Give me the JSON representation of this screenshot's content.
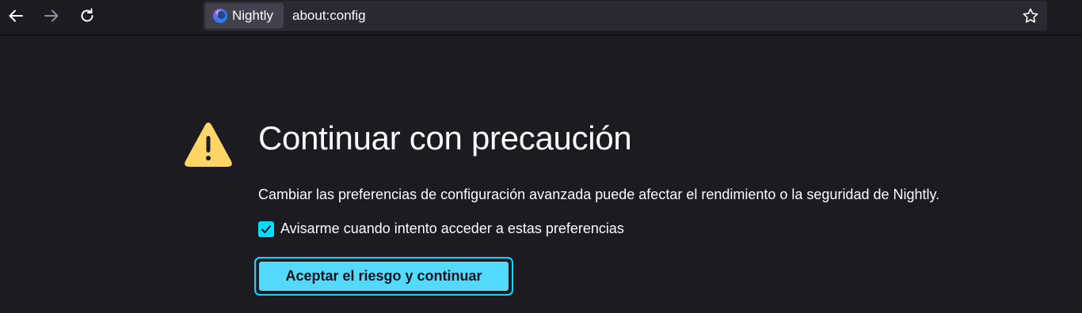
{
  "toolbar": {
    "back_icon": "arrow-left-icon",
    "forward_icon": "arrow-right-icon",
    "reload_icon": "reload-icon",
    "identity_label": "Nightly",
    "identity_icon": "nightly-logo-icon",
    "url": "about:config",
    "bookmark_icon": "star-icon"
  },
  "warning": {
    "icon": "warning-triangle-icon",
    "title": "Continuar con precaución",
    "description": "Cambiar las preferencias de configuración avanzada puede afectar el rendimiento o la seguridad de Nightly.",
    "checkbox_label": "Avisarme cuando intento acceder a estas preferencias",
    "checkbox_checked": true,
    "accept_button": "Aceptar el riesgo y continuar"
  },
  "colors": {
    "background": "#1c1b22",
    "urlbar": "#2b2a33",
    "accent": "#00ddff",
    "button": "#52d9fb",
    "warning": "#ffd567"
  }
}
